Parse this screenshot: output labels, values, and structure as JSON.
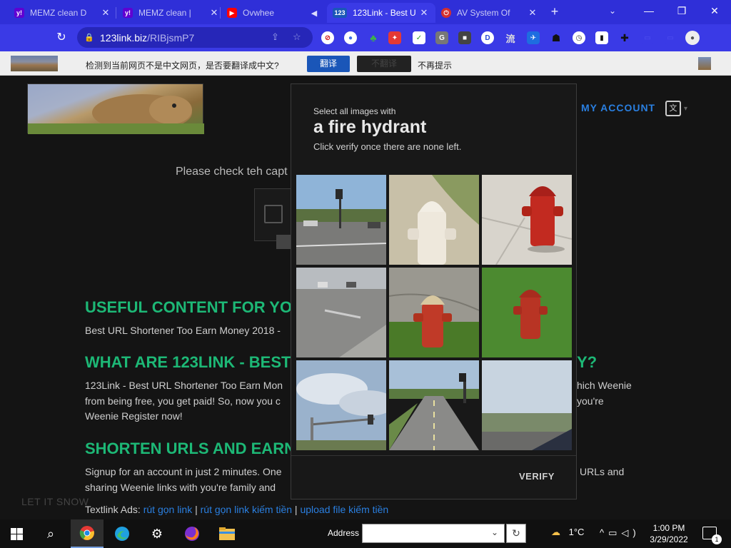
{
  "browser": {
    "tabs": [
      {
        "title": "MEMZ clean D",
        "favicon": "yahoo-icon",
        "color": "#6001d2"
      },
      {
        "title": "MEMZ clean |",
        "favicon": "yahoo-icon",
        "color": "#6001d2"
      },
      {
        "title": "Ovwhee",
        "favicon": "youtube-icon",
        "color": "#ff0000"
      },
      {
        "title": "123Link - Best U",
        "favicon": "123link-icon",
        "color": "#1a56b8",
        "active": true
      },
      {
        "title": "AV System Of",
        "favicon": "power-icon",
        "color": "#d32f2f"
      }
    ],
    "url_domain": "123link.biz",
    "url_path": "/RIBjsmP7"
  },
  "translate_bar": {
    "message": "检测到当前网页不是中文网页，是否要翻译成中文?",
    "translate_label": "翻译",
    "original_label": "不翻译",
    "never_label": "不再提示"
  },
  "site": {
    "my_account": "MY ACCOUNT",
    "captcha_prompt": "Please check teh capt",
    "h_useful": "USEFUL CONTENT FOR YO",
    "p_useful": "Best URL Shortener Too Earn Money 2018 -",
    "h_what": "WHAT ARE 123LINK - BEST",
    "h_what_tail": "Y?",
    "p_what_1": "123Link - Best URL Shortener Too Earn Mon",
    "p_what_1_tail": "hich Weenie",
    "p_what_2": "from being free, you get paid! So, now you c",
    "p_what_2_tail": "you're",
    "p_what_3": "Weenie Register now!",
    "h_shorten": "SHORTEN URLS AND EARN",
    "p_shorten_1": "Signup for an account in just 2 minutes. One",
    "p_shorten_1_tail": "URLs and",
    "p_shorten_2": "sharing Weenie links with you're family and",
    "let_it_snow": "LET IT SNOW",
    "textlink_label": "Textlink Ads:",
    "textlink_1": "rút gọn link",
    "textlink_2": "rút gọn link kiếm tiền",
    "textlink_3": "upload file kiếm tiền",
    "sep": "|"
  },
  "recaptcha": {
    "line1": "Select all images with",
    "target": "a fire hydrant",
    "line3": "Click verify once there are none left.",
    "verify_label": "VERIFY",
    "tiles": [
      {
        "scene": "street-intersection",
        "hydrant": false
      },
      {
        "scene": "white-hydrant-closeup",
        "hydrant": true
      },
      {
        "scene": "red-hydrant-sidewalk",
        "hydrant": true
      },
      {
        "scene": "parking-lot",
        "hydrant": false
      },
      {
        "scene": "red-hydrant-grass",
        "hydrant": true
      },
      {
        "scene": "red-hydrant-lawn",
        "hydrant": true
      },
      {
        "scene": "sky-traffic-light",
        "hydrant": false
      },
      {
        "scene": "road-highway",
        "hydrant": false
      },
      {
        "scene": "roadside-field",
        "hydrant": false
      }
    ]
  },
  "taskbar": {
    "address_label": "Address",
    "temperature": "1°C",
    "time": "1:00 PM",
    "date": "3/29/2022",
    "notifications": "1"
  }
}
